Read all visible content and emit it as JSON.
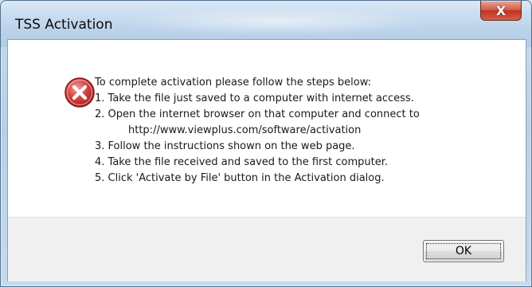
{
  "window": {
    "title": "TSS Activation",
    "close_glyph": "X"
  },
  "icon": {
    "name": "error-icon",
    "color": "#c62828"
  },
  "message": {
    "lines": [
      "To complete activation please follow the steps below:",
      "1. Take the file just saved to a computer with internet access.",
      "2. Open the internet browser on that computer and connect to",
      "http://www.viewplus.com/software/activation",
      "3. Follow the instructions shown on the web page.",
      "4. Take the file received and saved to the first computer.",
      "5. Click 'Activate by File' button in the Activation dialog."
    ]
  },
  "buttons": {
    "ok_label": "OK"
  }
}
